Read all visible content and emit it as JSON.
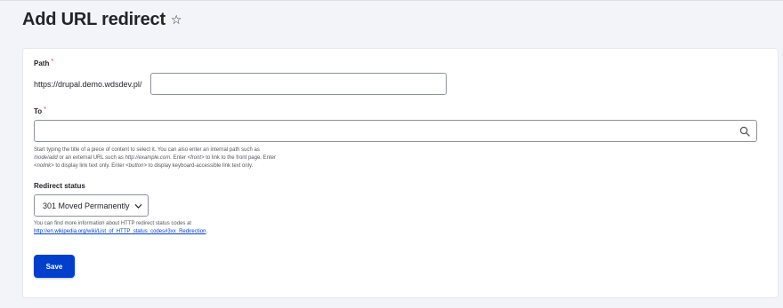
{
  "header": {
    "title": "Add URL redirect",
    "star_icon": "star-icon"
  },
  "colors": {
    "accent": "#003ecc",
    "required": "#dc2323",
    "background": "#f3f4f9"
  },
  "form": {
    "path": {
      "label": "Path",
      "required_mark": "*",
      "prefix": "https://drupal.demo.wdsdev.pl/",
      "value": ""
    },
    "to": {
      "label": "To",
      "required_mark": "*",
      "value": "",
      "icon": "search-icon",
      "description": [
        [
          {
            "t": "Start typing the title of a piece of content to select it. You can also enter an internal path such as ",
            "i": false
          },
          {
            "t": "",
            "i": false
          }
        ],
        [
          {
            "t": "/node/add",
            "i": true
          },
          {
            "t": " or an external URL such as ",
            "i": false
          },
          {
            "t": "http://example.com",
            "i": true
          },
          {
            "t": ". Enter ",
            "i": false
          },
          {
            "t": "<front>",
            "i": true
          },
          {
            "t": " to link to the front page. Enter",
            "i": false
          }
        ],
        [
          {
            "t": "<nolink>",
            "i": true
          },
          {
            "t": " to display link text only. Enter ",
            "i": false
          },
          {
            "t": "<button>",
            "i": true
          },
          {
            "t": " to display keyboard-accessible link text only.",
            "i": false
          }
        ]
      ]
    },
    "redirect_status": {
      "label": "Redirect status",
      "selected": "301 Moved Permanently",
      "chevron_icon": "chevron-down-icon",
      "help_text": "You can find more information about HTTP redirect status codes at",
      "help_link": "http://en.wikipedia.org/wiki/List_of_HTTP_status_codes#3xx_Redirection",
      "help_link_suffix": "."
    },
    "save_label": "Save"
  }
}
